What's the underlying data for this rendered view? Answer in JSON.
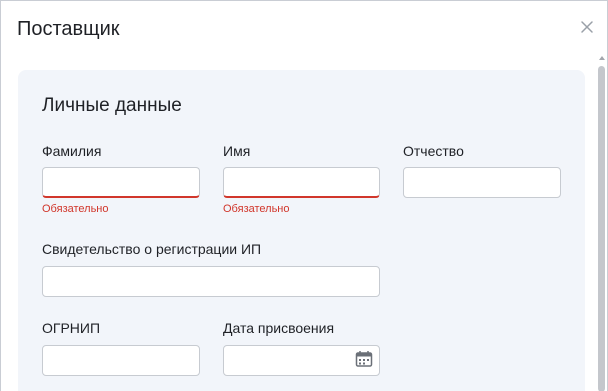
{
  "dialog": {
    "title": "Поставщик",
    "close_icon": "close-icon"
  },
  "section": {
    "title": "Личные данные"
  },
  "fields": {
    "last_name": {
      "label": "Фамилия",
      "value": "",
      "error": "Обязательно"
    },
    "first_name": {
      "label": "Имя",
      "value": "",
      "error": "Обязательно"
    },
    "middle_name": {
      "label": "Отчество",
      "value": ""
    },
    "ip_certificate": {
      "label": "Свидетельство о регистрации ИП",
      "value": ""
    },
    "ogrnip": {
      "label": "ОГРНИП",
      "value": ""
    },
    "assign_date": {
      "label": "Дата присвоения",
      "value": "",
      "icon": "calendar-icon"
    }
  },
  "colors": {
    "error": "#d1362b",
    "card_bg": "#f2f5fa",
    "border": "#c7cbd1",
    "text": "#1f2126"
  }
}
